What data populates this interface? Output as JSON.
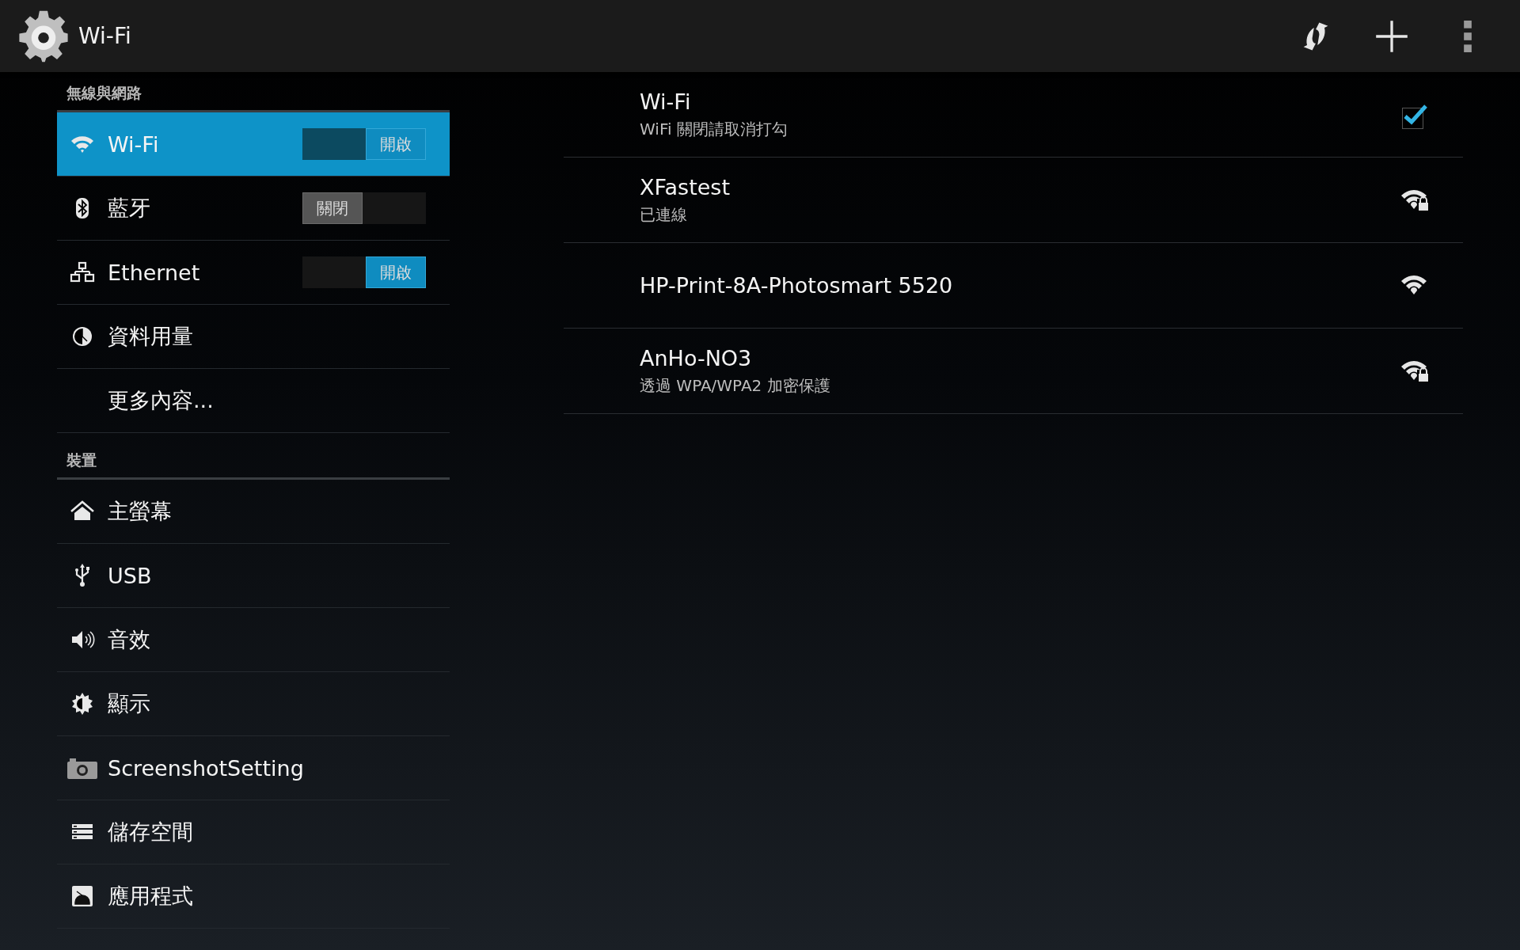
{
  "action_bar": {
    "title": "Wi-Fi"
  },
  "sidebar": {
    "sections": [
      {
        "header": "無線與網路",
        "items": [
          {
            "label": "Wi-Fi",
            "selected": true,
            "toggle": {
              "label": "開啟",
              "on": true
            }
          },
          {
            "label": "藍牙",
            "selected": false,
            "toggle": {
              "label": "關閉",
              "on": false
            }
          },
          {
            "label": "Ethernet",
            "selected": false,
            "toggle": {
              "label": "開啟",
              "on": true
            }
          },
          {
            "label": "資料用量",
            "selected": false
          },
          {
            "label": "更多內容...",
            "selected": false
          }
        ]
      },
      {
        "header": "裝置",
        "items": [
          {
            "label": "主螢幕",
            "selected": false
          },
          {
            "label": "USB",
            "selected": false
          },
          {
            "label": "音效",
            "selected": false
          },
          {
            "label": "顯示",
            "selected": false
          },
          {
            "label": "ScreenshotSetting",
            "selected": false
          },
          {
            "label": "儲存空間",
            "selected": false
          },
          {
            "label": "應用程式",
            "selected": false
          }
        ]
      }
    ]
  },
  "wifi_list": [
    {
      "kind": "checkbox",
      "title": "Wi-Fi",
      "summary": "WiFi 關閉請取消打勾",
      "checked": true
    },
    {
      "kind": "network",
      "title": "XFastest",
      "summary": "已連線",
      "secured": true
    },
    {
      "kind": "network",
      "title": "HP-Print-8A-Photosmart 5520",
      "secured": false
    },
    {
      "kind": "network",
      "title": "AnHo-NO3",
      "summary": "透過 WPA/WPA2 加密保護",
      "secured": true
    }
  ]
}
